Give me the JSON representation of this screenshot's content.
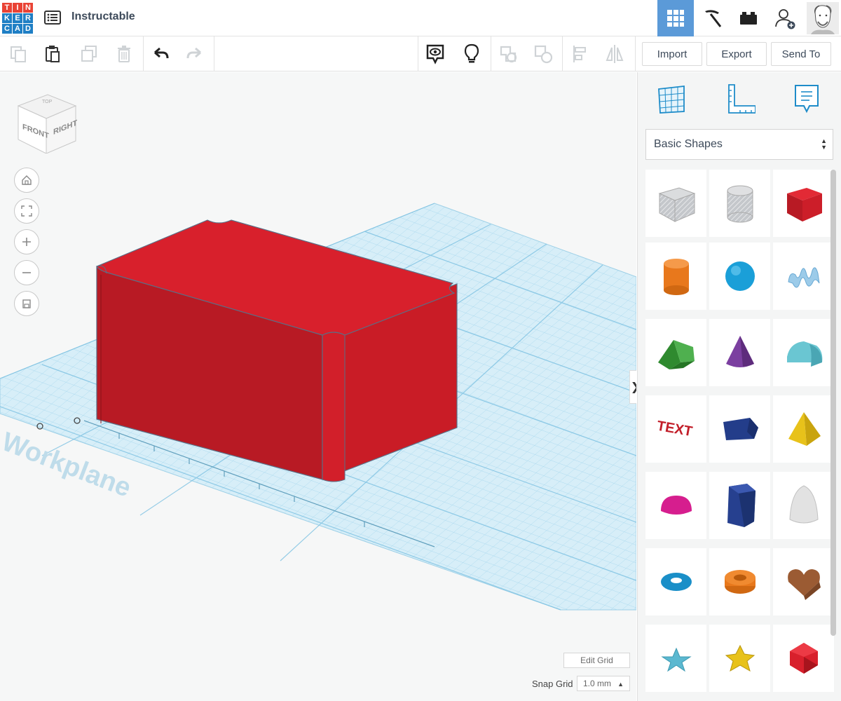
{
  "app": {
    "title": "Instructable",
    "logo_letters": [
      "T",
      "I",
      "N",
      "K",
      "E",
      "R",
      "C",
      "A",
      "D"
    ],
    "logo_colors": [
      "#e94335",
      "#e94335",
      "#e94335",
      "#1f7fc5",
      "#1f7fc5",
      "#1f7fc5",
      "#1f7fc5",
      "#1f7fc5",
      "#1f7fc5"
    ]
  },
  "header": {
    "buttons": [
      {
        "icon": "3d-design-grid-icon",
        "active": true
      },
      {
        "icon": "pickaxe-icon",
        "active": false
      },
      {
        "icon": "bricks-icon",
        "active": false
      },
      {
        "icon": "add-user-icon",
        "active": false
      },
      {
        "icon": "user-avatar",
        "active": false
      }
    ]
  },
  "toolbar": {
    "icons": [
      "copy-icon",
      "paste-icon",
      "duplicate-icon",
      "delete-icon",
      "undo-icon",
      "redo-icon",
      "show-hidden-icon",
      "notes-light-icon",
      "group-icon",
      "ungroup-icon",
      "align-icon",
      "mirror-icon"
    ],
    "import_label": "Import",
    "export_label": "Export",
    "send_to_label": "Send To"
  },
  "workspace": {
    "view_cube_labels": {
      "front": "FRONT",
      "right": "RIGHT",
      "top": "TOP"
    },
    "workplane_label": "Workplane",
    "edit_grid_label": "Edit Grid",
    "snap_grid_label": "Snap Grid",
    "snap_grid_value": "1.0 mm",
    "object_color": "#d8202c"
  },
  "panel": {
    "tabs": [
      "workplane-tab-icon",
      "ruler-tab-icon",
      "notes-tab-icon"
    ],
    "library_selected": "Basic Shapes",
    "shapes": [
      {
        "name": "box-hole",
        "color": "#b9bcc0"
      },
      {
        "name": "cylinder-hole",
        "color": "#c4c6c9"
      },
      {
        "name": "box",
        "color": "#d8202c"
      },
      {
        "name": "cylinder",
        "color": "#e8781c"
      },
      {
        "name": "sphere",
        "color": "#1a9fd8"
      },
      {
        "name": "scribble",
        "color": "#8fc3e6"
      },
      {
        "name": "roof",
        "color": "#3a9b3a"
      },
      {
        "name": "cone",
        "color": "#7b3fa0"
      },
      {
        "name": "round-roof",
        "color": "#5bbcc8"
      },
      {
        "name": "text",
        "color": "#c21f2a",
        "label": "TEXT"
      },
      {
        "name": "wedge",
        "color": "#233d8a"
      },
      {
        "name": "pyramid",
        "color": "#e8c21a"
      },
      {
        "name": "half-sphere",
        "color": "#d61e8e"
      },
      {
        "name": "polygon",
        "color": "#26408f"
      },
      {
        "name": "paraboloid",
        "color": "#d7d7d7"
      },
      {
        "name": "torus",
        "color": "#1a8fc8"
      },
      {
        "name": "tube",
        "color": "#e8781c"
      },
      {
        "name": "heart",
        "color": "#9b5b33"
      },
      {
        "name": "star",
        "color": "#5bb8d0"
      },
      {
        "name": "star-yellow",
        "color": "#e8c21a"
      },
      {
        "name": "icosahedron",
        "color": "#d8202c"
      }
    ]
  }
}
